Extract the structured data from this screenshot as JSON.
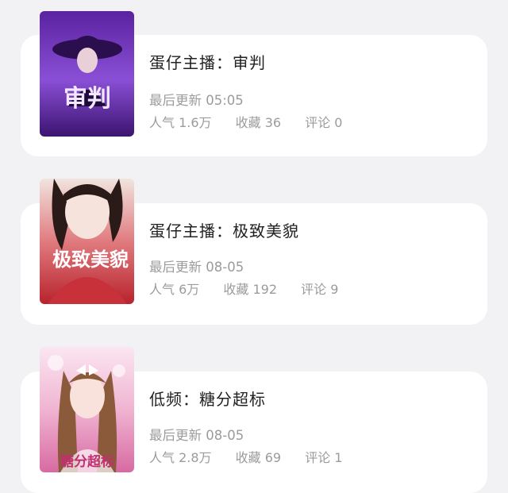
{
  "books": [
    {
      "title": "蛋仔主播：审判",
      "update": "最后更新 05:05",
      "popularity": "人气 1.6万",
      "favorites": "收藏 36",
      "comments": "评论 0",
      "cover_text": "审判",
      "cover_colors": [
        "#3b1470",
        "#7a3cc8",
        "#b07be8"
      ]
    },
    {
      "title": "蛋仔主播：极致美貌",
      "update": "最后更新 08-05",
      "popularity": "人气 6万",
      "favorites": "收藏 192",
      "comments": "评论 9",
      "cover_text": "极致美貌",
      "cover_colors": [
        "#e8d8d0",
        "#c8303a",
        "#7a1218"
      ]
    },
    {
      "title": "低频：糖分超标",
      "update": "最后更新 08-05",
      "popularity": "人气 2.8万",
      "favorites": "收藏 69",
      "comments": "评论 1",
      "cover_text": "糖分超标",
      "cover_colors": [
        "#f4d6e6",
        "#e89ac0",
        "#c04a86"
      ]
    }
  ]
}
